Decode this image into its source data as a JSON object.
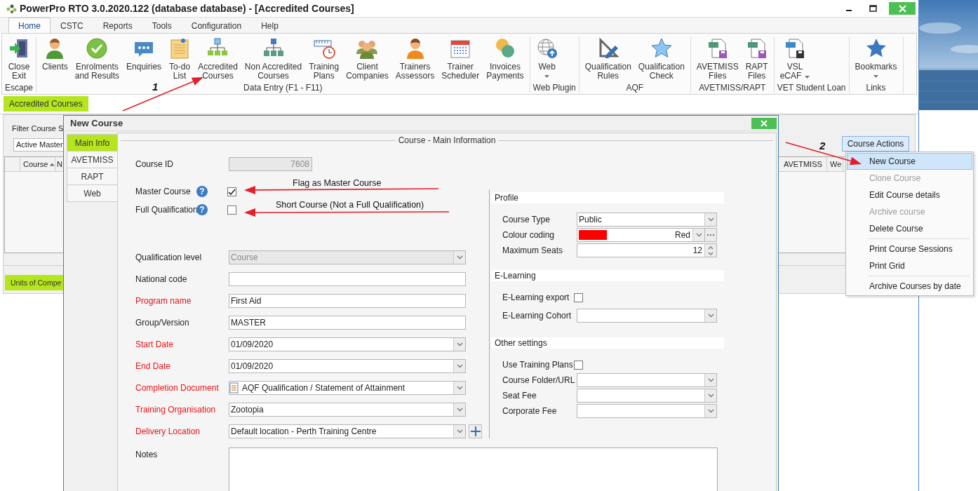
{
  "window": {
    "title": "PowerPro RTO 3.0.2020.122 (database database) - [Accredited Courses]"
  },
  "ribbon_tabs": [
    {
      "label": "Home",
      "selected": true
    },
    {
      "label": "CSTC",
      "selected": false
    },
    {
      "label": "Reports",
      "selected": false
    },
    {
      "label": "Tools",
      "selected": false
    },
    {
      "label": "Configuration",
      "selected": false
    },
    {
      "label": "Help",
      "selected": false
    }
  ],
  "ribbon_groups": [
    {
      "label": "Escape",
      "buttons": [
        {
          "lines": [
            "Close",
            "Exit"
          ],
          "dropdown": false
        }
      ]
    },
    {
      "label": "Data Entry (F1 - F11)",
      "buttons": [
        {
          "lines": [
            "Clients"
          ],
          "dropdown": false
        },
        {
          "lines": [
            "Enrolments",
            "and Results"
          ],
          "dropdown": false
        },
        {
          "lines": [
            "Enquiries"
          ],
          "dropdown": false
        },
        {
          "lines": [
            "To-do",
            "List"
          ],
          "dropdown": false
        },
        {
          "lines": [
            "Accredited",
            "Courses"
          ],
          "dropdown": false
        },
        {
          "lines": [
            "Non Accredited",
            "Courses"
          ],
          "dropdown": false
        },
        {
          "lines": [
            "Training",
            "Plans"
          ],
          "dropdown": false
        },
        {
          "lines": [
            "Client",
            "Companies"
          ],
          "dropdown": false
        },
        {
          "lines": [
            "Trainers",
            "Assessors"
          ],
          "dropdown": false
        },
        {
          "lines": [
            "Trainer",
            "Scheduler"
          ],
          "dropdown": false
        },
        {
          "lines": [
            "Invoices",
            "Payments"
          ],
          "dropdown": false
        }
      ]
    },
    {
      "label": "Web Plugin",
      "buttons": [
        {
          "lines": [
            "Web"
          ],
          "dropdown": true
        }
      ]
    },
    {
      "label": "AQF",
      "buttons": [
        {
          "lines": [
            "Qualification",
            "Rules"
          ],
          "dropdown": false
        },
        {
          "lines": [
            "Qualification",
            "Check"
          ],
          "dropdown": false
        }
      ]
    },
    {
      "label": "AVETMISS/RAPT",
      "buttons": [
        {
          "lines": [
            "AVETMISS",
            "Files"
          ],
          "dropdown": false
        },
        {
          "lines": [
            "RAPT",
            "Files"
          ],
          "dropdown": false
        }
      ]
    },
    {
      "label": "VET Student Loan",
      "buttons": [
        {
          "lines": [
            "VSL",
            "eCAF"
          ],
          "dropdown": true
        }
      ]
    },
    {
      "label": "Links",
      "buttons": [
        {
          "lines": [
            "Bookmarks"
          ],
          "dropdown": true
        }
      ]
    }
  ],
  "document_tabs": [
    {
      "label": "Accredited Courses",
      "selected": true
    }
  ],
  "course_list": {
    "filter_label": "Filter Course S",
    "filter_value": "Active Master",
    "columns_left": [
      {
        "label": "Course",
        "sorted": true
      },
      {
        "label": "N"
      }
    ],
    "columns_right": [
      {
        "label": "AVETMISS"
      },
      {
        "label": "We"
      }
    ],
    "actions_button": "Course Actions"
  },
  "lower_tabs": [
    {
      "label": "Units of Compe",
      "selected": true
    }
  ],
  "course_actions_menu": {
    "groups": [
      [
        {
          "label": "New Course",
          "highlighted": true,
          "disabled": false
        },
        {
          "label": "Clone Course",
          "highlighted": false,
          "disabled": true
        },
        {
          "label": "Edit Course details",
          "highlighted": false,
          "disabled": false
        },
        {
          "label": "Archive course",
          "highlighted": false,
          "disabled": true
        },
        {
          "label": "Delete Course",
          "highlighted": false,
          "disabled": false
        }
      ],
      [
        {
          "label": "Print Course Sessions",
          "highlighted": false,
          "disabled": false
        },
        {
          "label": "Print Grid",
          "highlighted": false,
          "disabled": false
        }
      ],
      [
        {
          "label": "Archive Courses by date",
          "highlighted": false,
          "disabled": false
        }
      ]
    ]
  },
  "dialog": {
    "title": "New Course",
    "tabs": [
      {
        "label": "Main Info",
        "selected": true
      },
      {
        "label": "AVETMISS",
        "selected": false
      },
      {
        "label": "RAPT",
        "selected": false
      },
      {
        "label": "Web",
        "selected": false
      }
    ],
    "legend": "Course - Main Information",
    "course_id": {
      "label": "Course ID",
      "value": "7608",
      "disabled": true
    },
    "flags": [
      {
        "label": "Master Course",
        "help": "?",
        "checked": true
      },
      {
        "label": "Full Qualification",
        "help": "?",
        "checked": false
      }
    ],
    "fields": [
      {
        "label": "Qualification level",
        "kind": "combo",
        "value": "Course",
        "required": false,
        "disabled": true
      },
      {
        "label": "National code",
        "kind": "text",
        "required": false,
        "disabled": false
      },
      {
        "label": "Program name",
        "kind": "text",
        "value": "First Aid",
        "required": true,
        "disabled": false
      },
      {
        "label": "Group/Version",
        "kind": "text",
        "value": "MASTER",
        "required": false,
        "disabled": false
      },
      {
        "label": "Start Date",
        "kind": "combo",
        "value": "01/09/2020",
        "required": true,
        "disabled": false
      },
      {
        "label": "End Date",
        "kind": "combo",
        "value": "01/09/2020",
        "required": true,
        "disabled": false
      },
      {
        "label": "Completion Document",
        "kind": "doccombo",
        "value": "AQF Qualification / Statement of Attainment",
        "required": true,
        "disabled": false
      },
      {
        "label": "Training Organisation",
        "kind": "combo",
        "value": "Zootopia",
        "required": true,
        "disabled": false
      },
      {
        "label": "Delivery Location",
        "kind": "addcombo",
        "value": "Default location - Perth Training Centre",
        "required": true,
        "disabled": false
      }
    ],
    "sections": [
      {
        "title": "Profile",
        "rows": [
          {
            "kind": "combo",
            "label": "Course Type",
            "value": "Public"
          },
          {
            "kind": "color",
            "label": "Colour coding",
            "value": "Red",
            "color": "#ff0000"
          },
          {
            "kind": "spin",
            "label": "Maximum Seats",
            "value": "12"
          }
        ]
      },
      {
        "title": "E-Learning",
        "rows": [
          {
            "kind": "check",
            "label": "E-Learning export",
            "checked": false
          },
          {
            "kind": "combo",
            "label": "E-Learning Cohort"
          }
        ]
      },
      {
        "title": "Other settings",
        "rows": [
          {
            "kind": "check",
            "label": "Use Training Plans",
            "checked": false
          },
          {
            "kind": "combo",
            "label": "Course Folder/URL"
          },
          {
            "kind": "combo",
            "label": "Seat Fee"
          },
          {
            "kind": "combo",
            "label": "Corporate Fee"
          }
        ]
      }
    ],
    "notes": {
      "label": "Notes"
    }
  },
  "annotations": [
    {
      "kind": "number",
      "text": "1"
    },
    {
      "kind": "number",
      "text": "2"
    },
    {
      "kind": "callout",
      "text": "Flag as Master Course"
    },
    {
      "kind": "callout",
      "text": "Short Course (Not a Full Qualification)"
    }
  ]
}
